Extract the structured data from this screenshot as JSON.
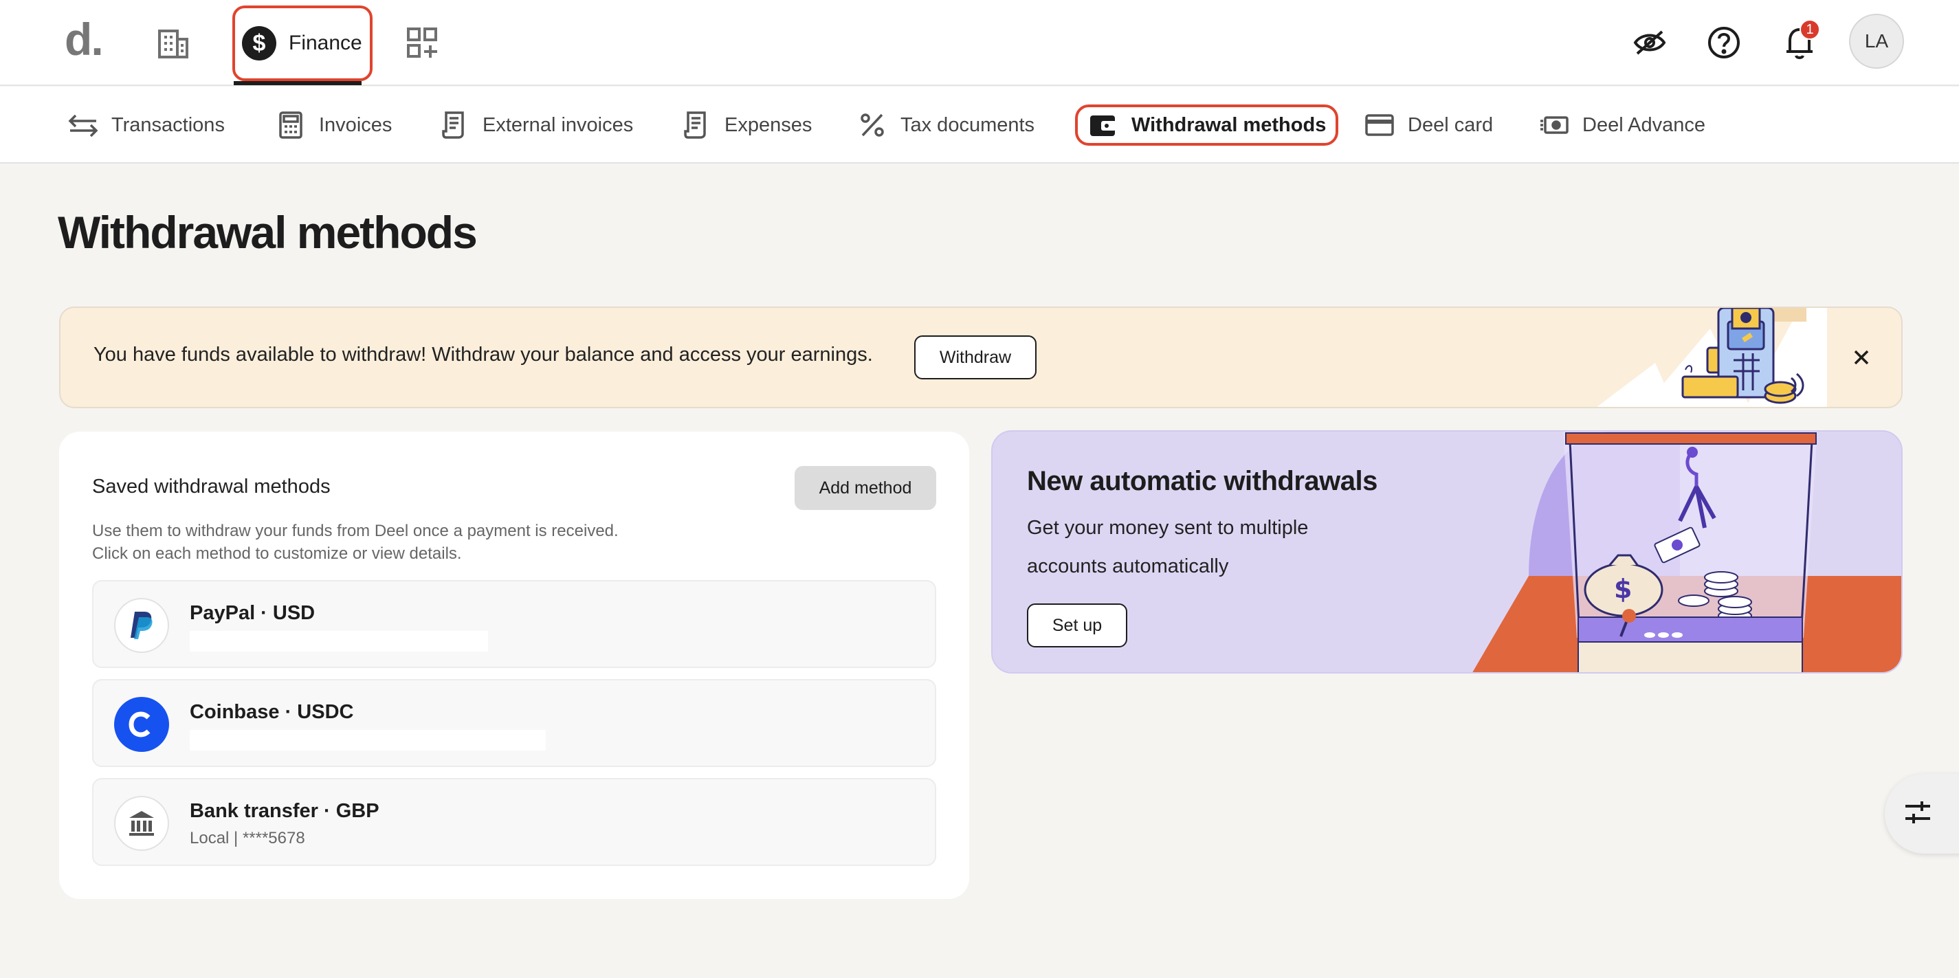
{
  "topbar": {
    "logo": "d.",
    "finance_label": "Finance",
    "finance_symbol": "$",
    "avatar_initials": "LA",
    "notification_count": "1",
    "icons": [
      "building-icon",
      "finance-icon",
      "apps-add-icon",
      "eye-off-icon",
      "help-icon",
      "bell-icon"
    ]
  },
  "subnav": {
    "items": [
      {
        "label": "Transactions",
        "icon": "transfer-arrows-icon"
      },
      {
        "label": "Invoices",
        "icon": "calculator-icon"
      },
      {
        "label": "External invoices",
        "icon": "receipt-icon"
      },
      {
        "label": "Expenses",
        "icon": "receipt-icon"
      },
      {
        "label": "Tax documents",
        "icon": "percent-icon"
      },
      {
        "label": "Withdrawal methods",
        "icon": "wallet-icon",
        "active": true
      },
      {
        "label": "Deel card",
        "icon": "credit-card-icon"
      },
      {
        "label": "Deel Advance",
        "icon": "cash-icon"
      }
    ]
  },
  "page": {
    "title": "Withdrawal methods"
  },
  "banner": {
    "text": "You have funds available to withdraw! Withdraw your balance and access your earnings.",
    "button_label": "Withdraw"
  },
  "saved_methods": {
    "title": "Saved withdrawal methods",
    "add_button_label": "Add method",
    "description_line1": "Use them to withdraw your funds from Deel once a payment is received.",
    "description_line2": "Click on each method to customize or view details.",
    "methods": [
      {
        "title": "PayPal · USD",
        "subtitle": "",
        "icon": "paypal-icon"
      },
      {
        "title": "Coinbase · USDC",
        "subtitle": "",
        "icon": "coinbase-icon"
      },
      {
        "title": "Bank transfer · GBP",
        "subtitle": "Local | ****5678",
        "icon": "bank-icon"
      }
    ]
  },
  "promo": {
    "title": "New automatic withdrawals",
    "text": "Get your money sent to multiple accounts automatically",
    "button_label": "Set up"
  },
  "colors": {
    "accent_outline": "#e0442e",
    "banner_bg": "#fbeedb",
    "promo_bg": "#ddd6f3",
    "coinbase_blue": "#1652f0",
    "badge_red": "#d83a2b"
  }
}
